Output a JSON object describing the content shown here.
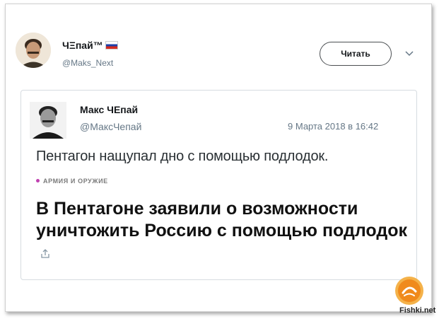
{
  "author": {
    "display_name": "ЧΞпай™",
    "handle": "@Maks_Next"
  },
  "follow_button_label": "Читать",
  "quoted": {
    "display_name": "Макс ЧЕпай",
    "handle": "@МаксЧепай",
    "date": "9 Марта 2018 в 16:42",
    "text": "Пентагон нащупал дно с помощью подлодок.",
    "category": "АРМИЯ И ОРУЖИЕ",
    "headline": "В Пентагоне заявили о возможности уничтожить Россию с помощью подлодок"
  },
  "watermark": "Fishki.net",
  "colors": {
    "category_dot": "#c03fb0",
    "muted_text": "#657786",
    "logo_orange": "#f0a020"
  }
}
